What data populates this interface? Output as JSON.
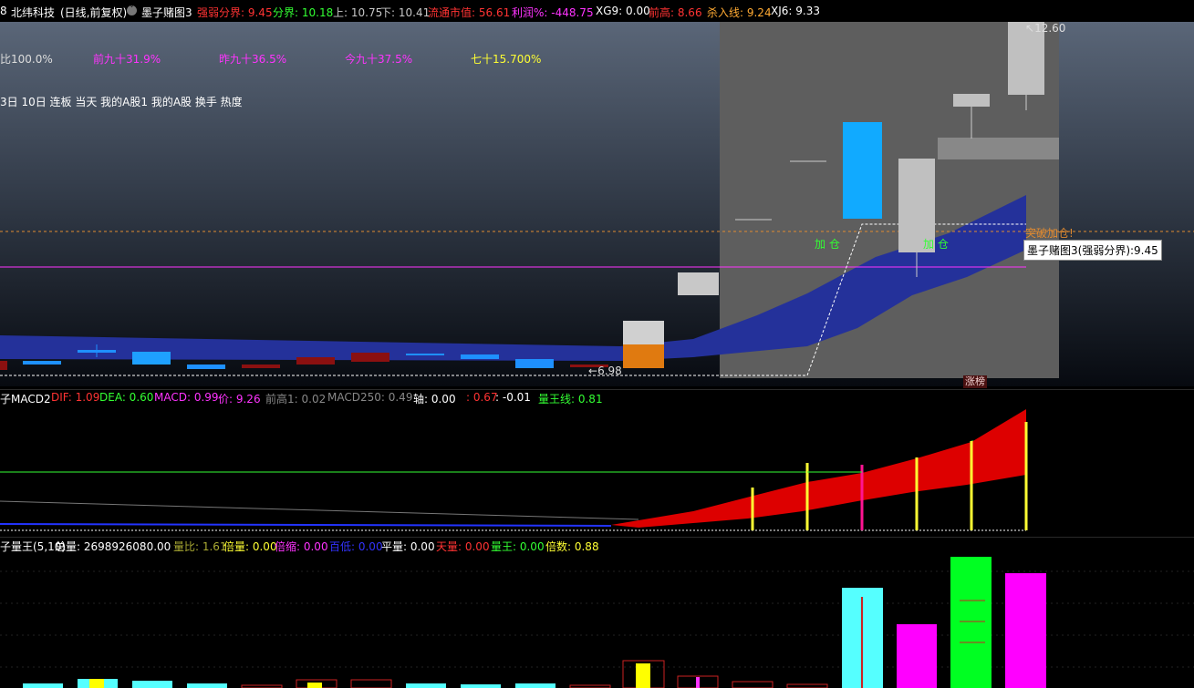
{
  "header": {
    "prefix": "8",
    "stock_name": "北纬科技",
    "period": "(日线,前复权)",
    "indicator_name": "墨子赌图3",
    "items": [
      {
        "label": "强弱分界:",
        "value": "9.45",
        "color": "#ff3333"
      },
      {
        "label": "分界:",
        "value": "10.18",
        "color": "#33ff33"
      },
      {
        "label": "上:",
        "value": "10.75",
        "color": "#c8c8c8"
      },
      {
        "label": "下:",
        "value": "10.41",
        "color": "#c8c8c8"
      },
      {
        "label": "流通市值:",
        "value": "56.61",
        "color": "#ff3333"
      },
      {
        "label": "利润%:",
        "value": "-448.75",
        "color": "#ff33ff"
      },
      {
        "label": "XG9:",
        "value": "0.00",
        "color": "#ffffff"
      },
      {
        "label": "前高:",
        "value": "8.66",
        "color": "#ff3333"
      },
      {
        "label": "杀入线:",
        "value": "9.24",
        "color": "#ffaa33"
      },
      {
        "label": "XJ6:",
        "value": "9.33",
        "color": "#ffffff"
      }
    ]
  },
  "main": {
    "ratio_row": [
      {
        "text": "比100.0%",
        "color": "#ffffff"
      },
      {
        "text": "前九十31.9%",
        "color": "#ff33ff"
      },
      {
        "text": "昨九十36.5%",
        "color": "#ff33ff"
      },
      {
        "text": "今九十37.5%",
        "color": "#ff33ff"
      },
      {
        "text": "七十15.700%",
        "color": "#ffff33"
      }
    ],
    "tag_row": "3日 10日 连板 当天 我的A股1 我的A股 换手 热度",
    "price_high": "12.60",
    "price_low": "6.98",
    "breakout_label": "突破加仓!",
    "add_label_1": "加 仓",
    "add_label_2": "加 仓",
    "tooltip": "墨子赌图3(强弱分界):9.45",
    "limit_up_tag": "涨榜"
  },
  "macd": {
    "title": "子MACD2",
    "items": [
      {
        "label": "DIF:",
        "value": "1.09",
        "color": "#ff3333"
      },
      {
        "label": "DEA:",
        "value": "0.60",
        "color": "#33ff33"
      },
      {
        "label": "MACD:",
        "value": "0.99",
        "color": "#ff33ff"
      },
      {
        "label": "价:",
        "value": "9.26",
        "color": "#ff33ff"
      },
      {
        "label": "前高1:",
        "value": "0.02",
        "color": "#888888"
      },
      {
        "label": "MACD250:",
        "value": "0.49",
        "color": "#888888"
      },
      {
        "label": "轴:",
        "value": "0.00",
        "color": "#ffffff"
      },
      {
        "label": ":",
        "value": "0.67",
        "color": "#ff3333"
      },
      {
        "label": ":",
        "value": "-0.01",
        "color": "#ffffff"
      },
      {
        "label": "量王线:",
        "value": "0.81",
        "color": "#33ff33"
      }
    ]
  },
  "volume": {
    "title": "子量王(5,10)",
    "items": [
      {
        "label": "总量:",
        "value": "2698926080.00",
        "color": "#ffffff"
      },
      {
        "label": "量比:",
        "value": "1.61",
        "color": "#aaaa33"
      },
      {
        "label": "倍量:",
        "value": "0.00",
        "color": "#ffff33"
      },
      {
        "label": "倍缩:",
        "value": "0.00",
        "color": "#ff33ff"
      },
      {
        "label": "百低:",
        "value": "0.00",
        "color": "#3333ff"
      },
      {
        "label": "平量:",
        "value": "0.00",
        "color": "#ffffff"
      },
      {
        "label": "天量:",
        "value": "0.00",
        "color": "#ff3333"
      },
      {
        "label": "量王:",
        "value": "0.00",
        "color": "#33ff33"
      },
      {
        "label": "倍数:",
        "value": "0.88",
        "color": "#ffff33"
      }
    ]
  }
}
